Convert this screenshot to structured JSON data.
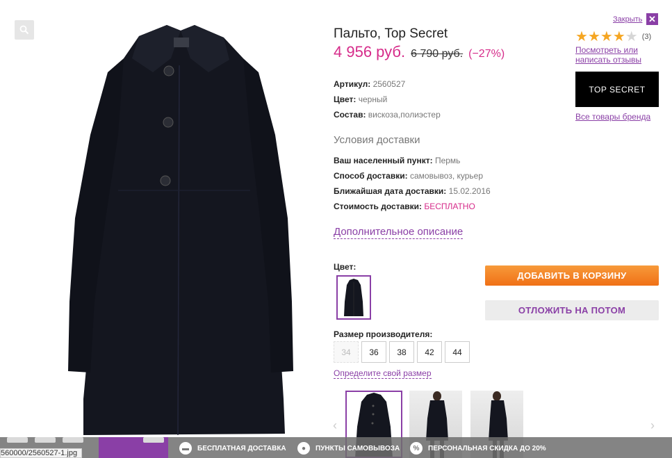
{
  "product": {
    "title": "Пальто, Top Secret",
    "price_new": "4 956 руб.",
    "price_old": "6 790 руб.",
    "discount": "(−27%)",
    "sku_label": "Артикул:",
    "sku": "2560527",
    "color_label": "Цвет:",
    "color": "черный",
    "composition_label": "Состав:",
    "composition": "вискоза,полиэстер"
  },
  "delivery": {
    "heading": "Условия доставки",
    "city_label": "Ваш населенный пункт:",
    "city": "Пермь",
    "method_label": "Способ доставки:",
    "method": "самовывоз, курьер",
    "date_label": "Ближайшая дата доставки:",
    "date": "15.02.2016",
    "cost_label": "Стоимость доставки:",
    "cost": "БЕСПЛАТНО"
  },
  "more_description": "Дополнительное описание",
  "color_select_label": "Цвет:",
  "sizes": {
    "label": "Размер производителя:",
    "options": [
      "34",
      "36",
      "38",
      "42",
      "44"
    ],
    "disabled": [
      "34"
    ],
    "size_help": "Определите свой размер"
  },
  "right": {
    "close": "Закрыть",
    "close_x": "✕",
    "rating": 4,
    "rating_count": "(3)",
    "reviews_link": "Посмотреть или написать отзывы",
    "brand_logo_text": "TOP SECRET",
    "brand_link": "Все товары бренда"
  },
  "buttons": {
    "add_to_cart": "ДОБАВИТЬ В КОРЗИНУ",
    "save_later": "ОТЛОЖИТЬ НА ПОТОМ"
  },
  "bottom_bar": {
    "free_delivery": "БЕСПЛАТНАЯ ДОСТАВКА",
    "pickup": "ПУНКТЫ САМОВЫВОЗА",
    "discount": "ПЕРСОНАЛЬНАЯ СКИДКА ДО 20%"
  },
  "status_url": "560000/2560527-1.jpg",
  "colors": {
    "accent": "#8a3fa6",
    "price": "#d62b8a",
    "cart_button": "#f47b20"
  }
}
